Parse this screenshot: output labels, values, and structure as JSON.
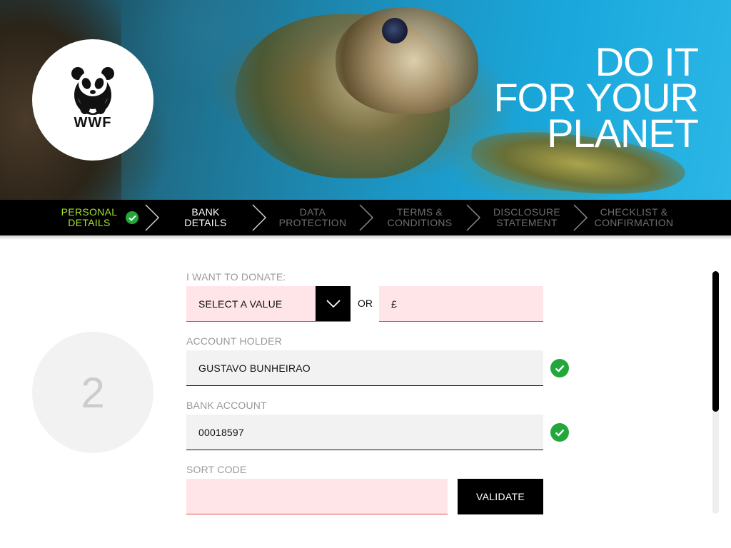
{
  "hero": {
    "headline_lines": [
      "DO IT",
      "FOR YOUR",
      "PLANET"
    ],
    "logo_text": "WWF",
    "photo": "sea-turtle-underwater"
  },
  "steps": [
    {
      "label_line1": "PERSONAL",
      "label_line2": "DETAILS",
      "state": "done"
    },
    {
      "label_line1": "BANK",
      "label_line2": "DETAILS",
      "state": "current"
    },
    {
      "label_line1": "DATA",
      "label_line2": "PROTECTION",
      "state": "upcoming"
    },
    {
      "label_line1": "TERMS &",
      "label_line2": "CONDITIONS",
      "state": "upcoming"
    },
    {
      "label_line1": "DISCLOSURE",
      "label_line2": "STATEMENT",
      "state": "upcoming"
    },
    {
      "label_line1": "CHECKLIST &",
      "label_line2": "CONFIRMATION",
      "state": "upcoming"
    }
  ],
  "current_step_number": "2",
  "form": {
    "donate": {
      "label": "I WANT TO DONATE:",
      "select_value": "SELECT A VALUE",
      "or_text": "OR",
      "amount_prefix": "£",
      "amount_value": ""
    },
    "account_holder": {
      "label": "ACCOUNT HOLDER",
      "value": "GUSTAVO BUNHEIRAO",
      "valid": true
    },
    "bank_account": {
      "label": "BANK ACCOUNT",
      "value": "00018597",
      "valid": true
    },
    "sort_code": {
      "label": "SORT CODE",
      "value": "",
      "button_label": "VALIDATE"
    }
  },
  "colors": {
    "done_step": "#a6e22e",
    "valid_green": "#22a83a",
    "error_bg": "#ffe5e8",
    "error_line": "#e0484f"
  },
  "scrollbar": {
    "position_fraction": 0.0,
    "visible_fraction": 0.58
  }
}
